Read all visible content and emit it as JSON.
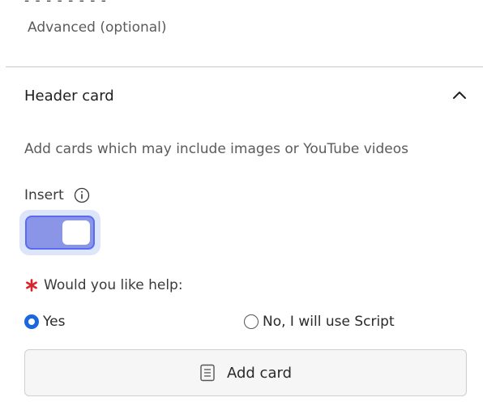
{
  "top_partial": "- - - - - - - -",
  "advanced_label": "Advanced (optional)",
  "section": {
    "title": "Header card",
    "expanded": true,
    "description": "Add cards which may include images or YouTube videos"
  },
  "insert": {
    "label": "Insert",
    "enabled": true
  },
  "help_question": {
    "label": "Would you like help:",
    "required": true,
    "options": [
      {
        "label": "Yes",
        "selected": true
      },
      {
        "label": "No, I will use Script",
        "selected": false
      }
    ]
  },
  "add_card_button": {
    "label": "Add card"
  },
  "colors": {
    "accent": "#1a67e0",
    "toggle_fill": "#8a95e8",
    "required": "#d6262b"
  }
}
